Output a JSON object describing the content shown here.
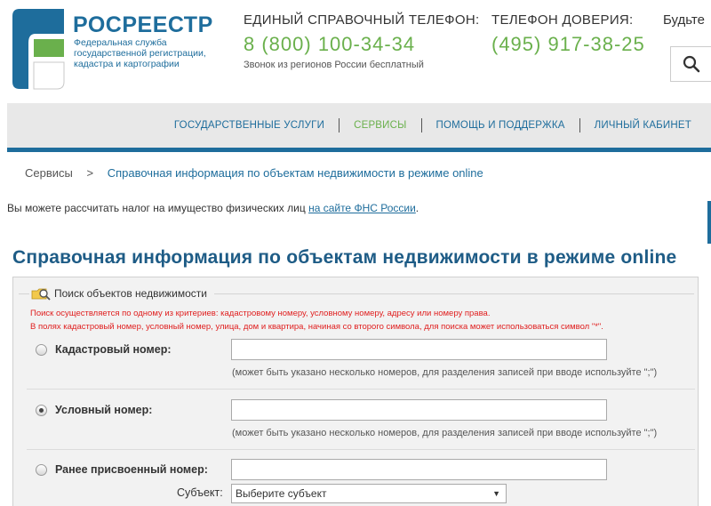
{
  "header": {
    "brand_name": "РОСРЕЕСТР",
    "brand_sub_1": "Федеральная служба",
    "brand_sub_2": "государственной регистрации,",
    "brand_sub_3": "кадастра и картографии",
    "phone1": {
      "label": "ЕДИНЫЙ СПРАВОЧНЫЙ ТЕЛЕФОН:",
      "number": "8 (800) 100-34-34",
      "note": "Звонок из регионов России бесплатный"
    },
    "phone2": {
      "label": "ТЕЛЕФОН ДОВЕРИЯ:",
      "number": "(495) 917-38-25"
    },
    "cut_text": "Будьте",
    "search_icon": "search-icon"
  },
  "nav": {
    "items": [
      {
        "label": "ГОСУДАРСТВЕННЫЕ УСЛУГИ",
        "active": false
      },
      {
        "label": "СЕРВИСЫ",
        "active": true
      },
      {
        "label": "ПОМОЩЬ И ПОДДЕРЖКА",
        "active": false
      },
      {
        "label": "ЛИЧНЫЙ КАБИНЕТ",
        "active": false
      }
    ]
  },
  "breadcrumb": {
    "root": "Сервисы",
    "separator": ">",
    "current": "Справочная информация по объектам недвижимости в режиме online"
  },
  "tax": {
    "text": "Вы можете рассчитать налог на имущество физических лиц ",
    "link": "на сайте ФНС России",
    "suffix": "."
  },
  "page_title": "Справочная информация по объектам недвижимости в режиме online",
  "form": {
    "legend": "Поиск объектов недвижимости",
    "warning1": "Поиск осуществляется по одному из критериев: кадастровому номеру, условному номеру, адресу или номеру права.",
    "warning2": "В полях кадастровый номер, условный номер, улица, дом и квартира, начиная со второго символа, для поиска может использоваться символ \"*\".",
    "cadastral": {
      "label": "Кадастровый номер:",
      "value": "",
      "hint": "(может быть указано несколько номеров, для разделения записей при вводе используйте \";\")",
      "checked": false
    },
    "conditional": {
      "label": "Условный номер:",
      "value": "",
      "hint": "(может быть указано несколько номеров, для разделения записей при вводе используйте \";\")",
      "checked": true
    },
    "previous": {
      "label": "Ранее присвоенный номер:",
      "value": "",
      "checked": false
    },
    "subject": {
      "label": "Субъект:",
      "selected": "Выберите субъект"
    }
  },
  "colors": {
    "brand_blue": "#1e6d9c",
    "phone_green": "#6ab04c",
    "warning_red": "#e02020"
  }
}
